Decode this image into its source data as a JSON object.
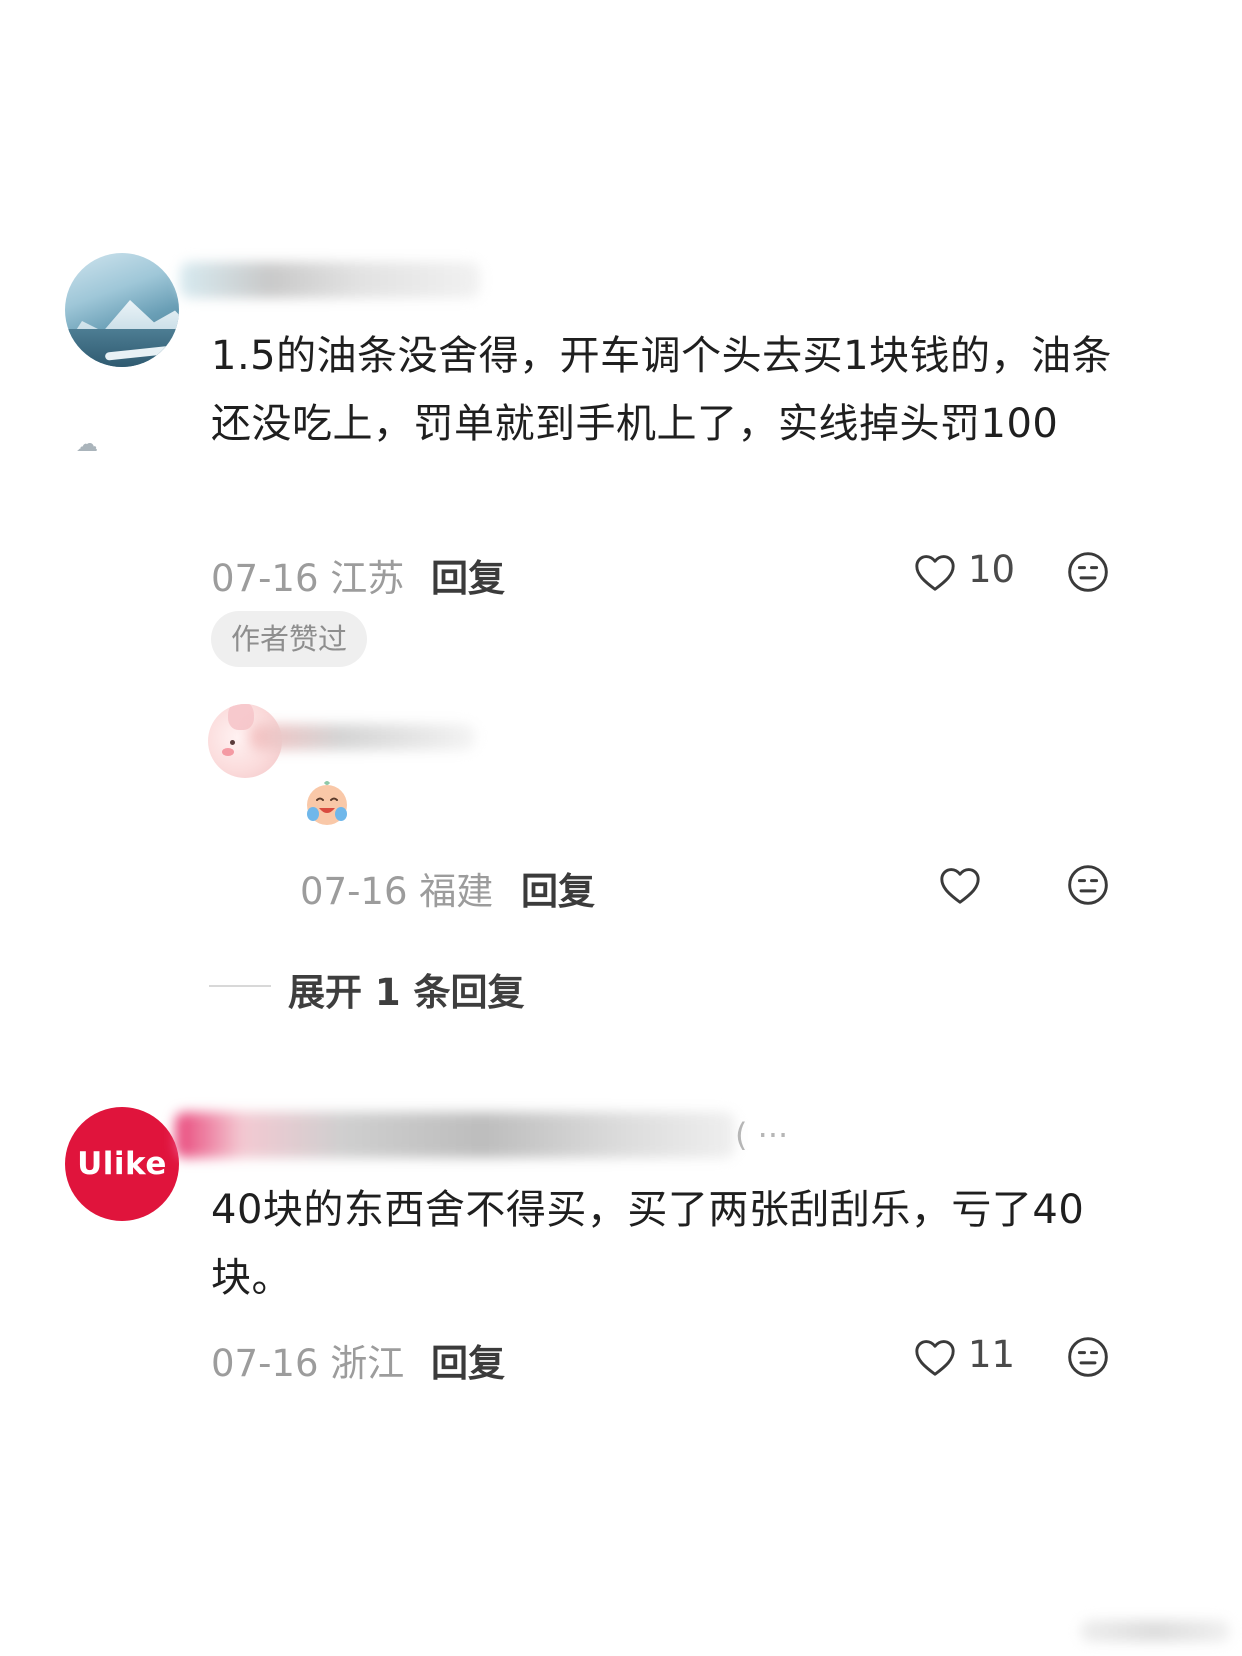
{
  "comments": [
    {
      "text": "1.5的油条没舍得，开车调个头去买1块钱的，油条还没吃上，罚单就到手机上了，实线掉头罚100",
      "date": "07-16",
      "location": "江苏",
      "reply_label": "回复",
      "likes": "10",
      "author_liked": "作者赞过",
      "replies": [
        {
          "date": "07-16",
          "location": "福建",
          "reply_label": "回复",
          "likes": ""
        }
      ],
      "expand_label": "展开 1 条回复"
    },
    {
      "avatar_text": "Ulike",
      "name_tail": "( ···",
      "text": "40块的东西舍不得买，买了两张刮刮乐，亏了40块。",
      "date": "07-16",
      "location": "浙江",
      "reply_label": "回复",
      "likes": "11"
    }
  ],
  "icons": {
    "like": "heart-outline-icon",
    "dislike": "neutral-face-icon",
    "reply_emoji": "crying-laughing-emoji-icon"
  },
  "colors": {
    "ulike_brand": "#e0143c",
    "meta_gray": "#9c9c9c"
  }
}
